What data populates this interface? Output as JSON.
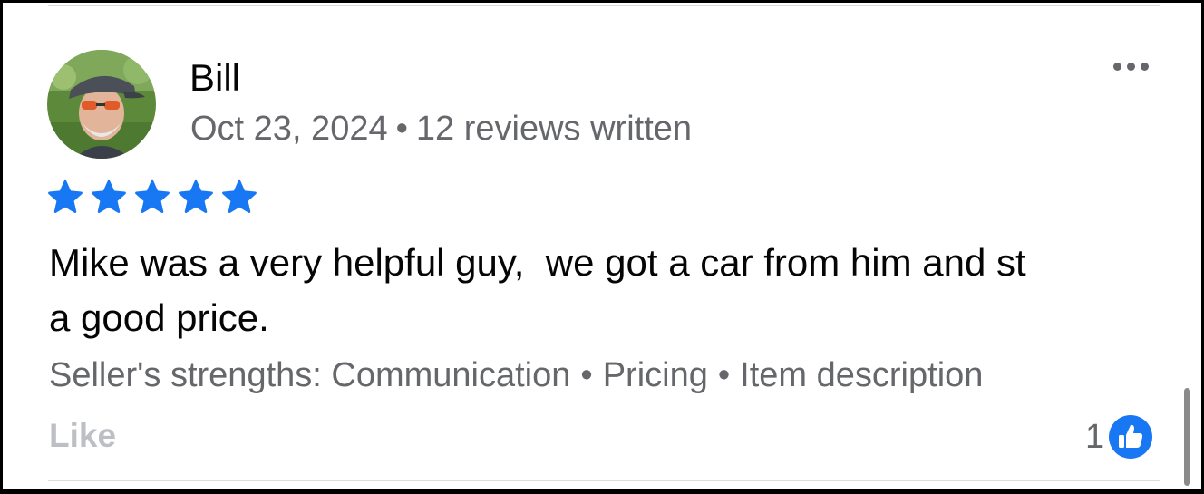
{
  "review": {
    "reviewer_name": "Bill",
    "date": "Oct 23, 2024",
    "separator": "•",
    "reviews_written": "12 reviews written",
    "rating": 5,
    "rating_max": 5,
    "text": "Mike was a very helpful guy,  we got a car from him and st\na good price.",
    "strengths_label": "Seller's strengths:",
    "strengths": [
      "Communication",
      "Pricing",
      "Item description"
    ],
    "like_label": "Like",
    "reaction_count": "1"
  },
  "icons": {
    "avatar": "avatar",
    "more": "more-horizontal-icon",
    "star": "star-icon",
    "reaction": "thumbs-up-icon"
  },
  "colors": {
    "star": "#1877f2",
    "like_reaction": "#1877f2",
    "secondary_text": "#65676b",
    "like_label": "#bcc0c4"
  }
}
